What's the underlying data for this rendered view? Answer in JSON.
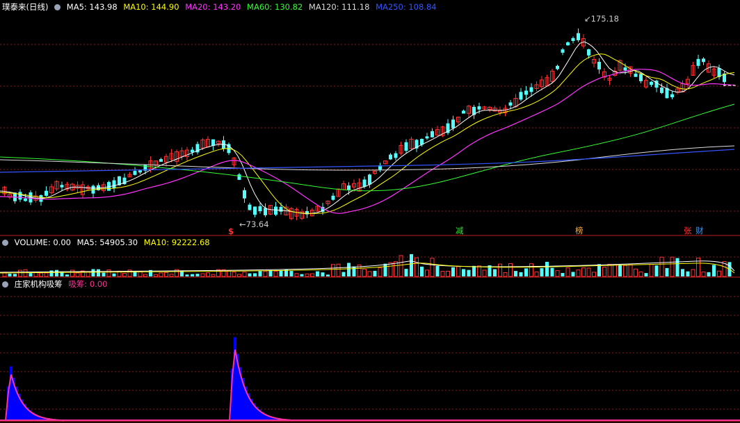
{
  "main": {
    "title": "璞泰来(日线)",
    "ma": [
      {
        "label": "MA5: 143.98",
        "color": "#ffffff"
      },
      {
        "label": "MA10: 144.90",
        "color": "#ffff00"
      },
      {
        "label": "MA20: 143.20",
        "color": "#ff33ff"
      },
      {
        "label": "MA60: 130.82",
        "color": "#33ff33"
      },
      {
        "label": "MA120: 111.18",
        "color": "#dddddd"
      },
      {
        "label": "MA250: 108.84",
        "color": "#3355ff"
      }
    ],
    "high_label": "175.18",
    "low_label": "73.64",
    "signals": [
      {
        "text": "$",
        "color": "#ff3333"
      },
      {
        "text": "减",
        "color": "#33dd33"
      },
      {
        "text": "榜",
        "color": "#ffaa33"
      },
      {
        "text": "张",
        "color": "#ff3333"
      },
      {
        "text": "财",
        "color": "#3399ff"
      }
    ]
  },
  "volume": {
    "title": "VOLUME: 0.00",
    "ma5": "MA5: 54905.30",
    "ma10": "MA10: 92222.68"
  },
  "indicator": {
    "title": "庄家机构吸筹",
    "value": "吸筹: 0.00"
  },
  "chart_data": {
    "type": "candlestick",
    "price_range_approx": [
      70,
      180
    ],
    "high": 175.18,
    "low": 73.64,
    "series": [
      "MA5",
      "MA10",
      "MA20",
      "MA60",
      "MA120",
      "MA250"
    ],
    "indicator_peaks": [
      "early",
      "middle"
    ]
  },
  "colors": {
    "up": "#ff3333",
    "down": "#54fcfc",
    "grid": "#8b1a1a",
    "border": "#c81e1e",
    "indicator_bar": "#0000ff",
    "indicator_line": "#ff3399"
  }
}
